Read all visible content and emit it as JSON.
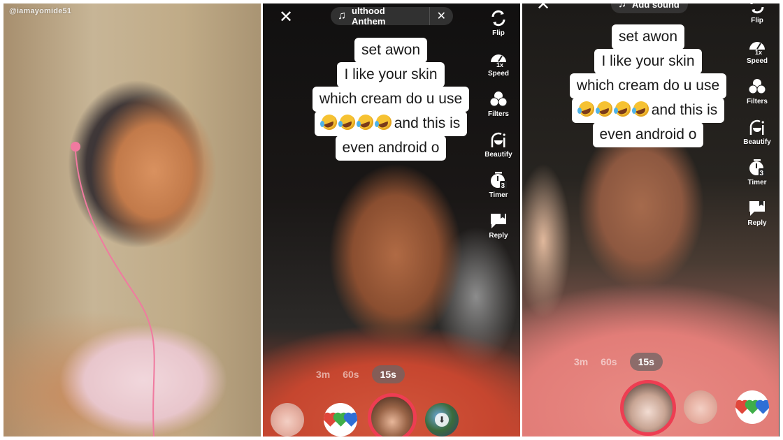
{
  "panels": [
    {
      "id": "selfie",
      "watermark": "@iamayomide51"
    },
    {
      "id": "camera-1",
      "close_label": "✕",
      "sound": {
        "title": "ulthood Anthem",
        "remove_label": "✕",
        "icon": "music-note-icon"
      },
      "toolbar": [
        {
          "label": "Flip",
          "icon": "flip-camera-icon"
        },
        {
          "label": "Speed",
          "icon": "speed-icon",
          "badge": "1x"
        },
        {
          "label": "Filters",
          "icon": "filters-icon"
        },
        {
          "label": "Beautify",
          "icon": "beautify-icon"
        },
        {
          "label": "Timer",
          "icon": "timer-icon",
          "badge": "3"
        },
        {
          "label": "Reply",
          "icon": "reply-icon"
        }
      ],
      "caption": {
        "lines": [
          "set awon",
          "I like your skin",
          "which cream do u use",
          "and this is",
          "even android o"
        ],
        "emoji": "rolling-on-floor-laughing",
        "emoji_count": 4
      },
      "durations": [
        "3m",
        "60s",
        "15s"
      ],
      "active_duration": "15s",
      "effects": [
        "effect-face",
        "effect-hearts",
        "record-effect-face",
        "effect-download"
      ]
    },
    {
      "id": "camera-2",
      "close_label": "✕",
      "sound": {
        "title": "Add sound",
        "icon": "music-note-icon"
      },
      "toolbar": [
        {
          "label": "Flip",
          "icon": "flip-camera-icon"
        },
        {
          "label": "Speed",
          "icon": "speed-icon",
          "badge": "1x"
        },
        {
          "label": "Filters",
          "icon": "filters-icon"
        },
        {
          "label": "Beautify",
          "icon": "beautify-icon"
        },
        {
          "label": "Timer",
          "icon": "timer-icon",
          "badge": "3"
        },
        {
          "label": "Reply",
          "icon": "reply-icon"
        }
      ],
      "caption": {
        "lines": [
          "set awon",
          "I like your skin",
          "which cream do u use",
          "and this is",
          "even android o"
        ],
        "emoji": "rolling-on-floor-laughing",
        "emoji_count": 4
      },
      "durations": [
        "3m",
        "60s",
        "15s"
      ],
      "active_duration": "15s",
      "effects": [
        "record-effect-face",
        "effect-face",
        "effect-hearts"
      ]
    }
  ],
  "colors": {
    "record_ring": "#ee3d52",
    "heart_red": "#e0463a",
    "heart_green": "#3fae49",
    "heart_blue": "#2f6fd6",
    "caption_bg": "#ffffff",
    "caption_text": "#1a1a1a"
  }
}
